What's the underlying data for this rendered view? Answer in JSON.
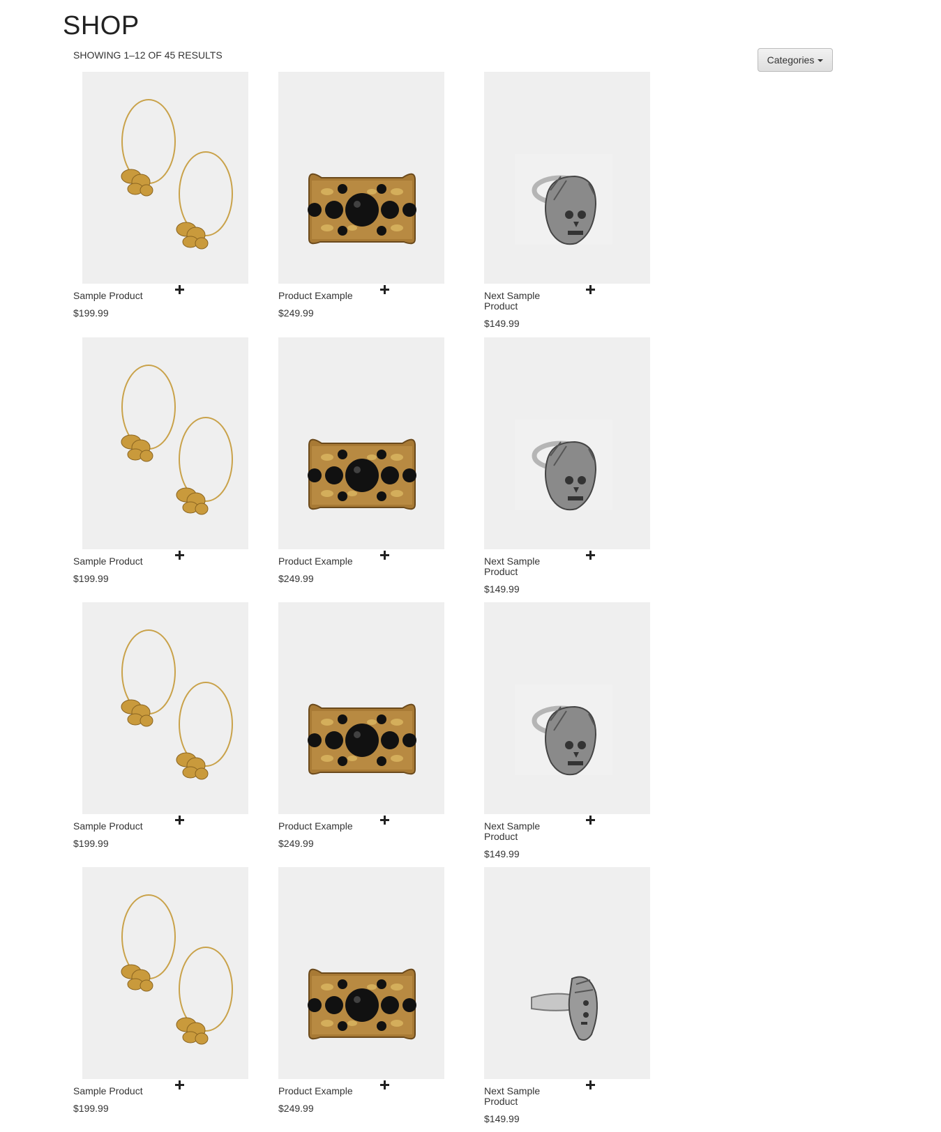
{
  "page": {
    "title": "SHOP",
    "result_count": "SHOWING 1–12 OF 45 RESULTS",
    "categories_label": "Categories"
  },
  "products": [
    {
      "name": "Sample Product",
      "price": "$199.99",
      "image": "gold-butterfly-hoop-earrings"
    },
    {
      "name": "Product Example",
      "price": "$249.99",
      "image": "gold-cuff-bracelet-black-stones"
    },
    {
      "name": "Next Sample Product",
      "price": "$149.99",
      "image": "silver-skull-headdress-ring"
    },
    {
      "name": "Sample Product",
      "price": "$199.99",
      "image": "gold-butterfly-hoop-earrings"
    },
    {
      "name": "Product Example",
      "price": "$249.99",
      "image": "gold-cuff-bracelet-black-stones"
    },
    {
      "name": "Next Sample Product",
      "price": "$149.99",
      "image": "silver-skull-headdress-ring"
    },
    {
      "name": "Sample Product",
      "price": "$199.99",
      "image": "gold-butterfly-hoop-earrings"
    },
    {
      "name": "Product Example",
      "price": "$249.99",
      "image": "gold-cuff-bracelet-black-stones"
    },
    {
      "name": "Next Sample Product",
      "price": "$149.99",
      "image": "silver-skull-headdress-ring"
    },
    {
      "name": "Sample Product",
      "price": "$199.99",
      "image": "gold-butterfly-hoop-earrings"
    },
    {
      "name": "Product Example",
      "price": "$249.99",
      "image": "gold-cuff-bracelet-black-stones"
    },
    {
      "name": "Next Sample Product",
      "price": "$149.99",
      "image": "silver-skull-headdress-ring-side"
    }
  ],
  "icons": {
    "add_to_cart": "plus-icon",
    "dropdown": "caret-down-icon"
  },
  "colors": {
    "thumb_bg": "#efefef",
    "gold": "#c9a24a",
    "silver": "#a9a9a9"
  }
}
